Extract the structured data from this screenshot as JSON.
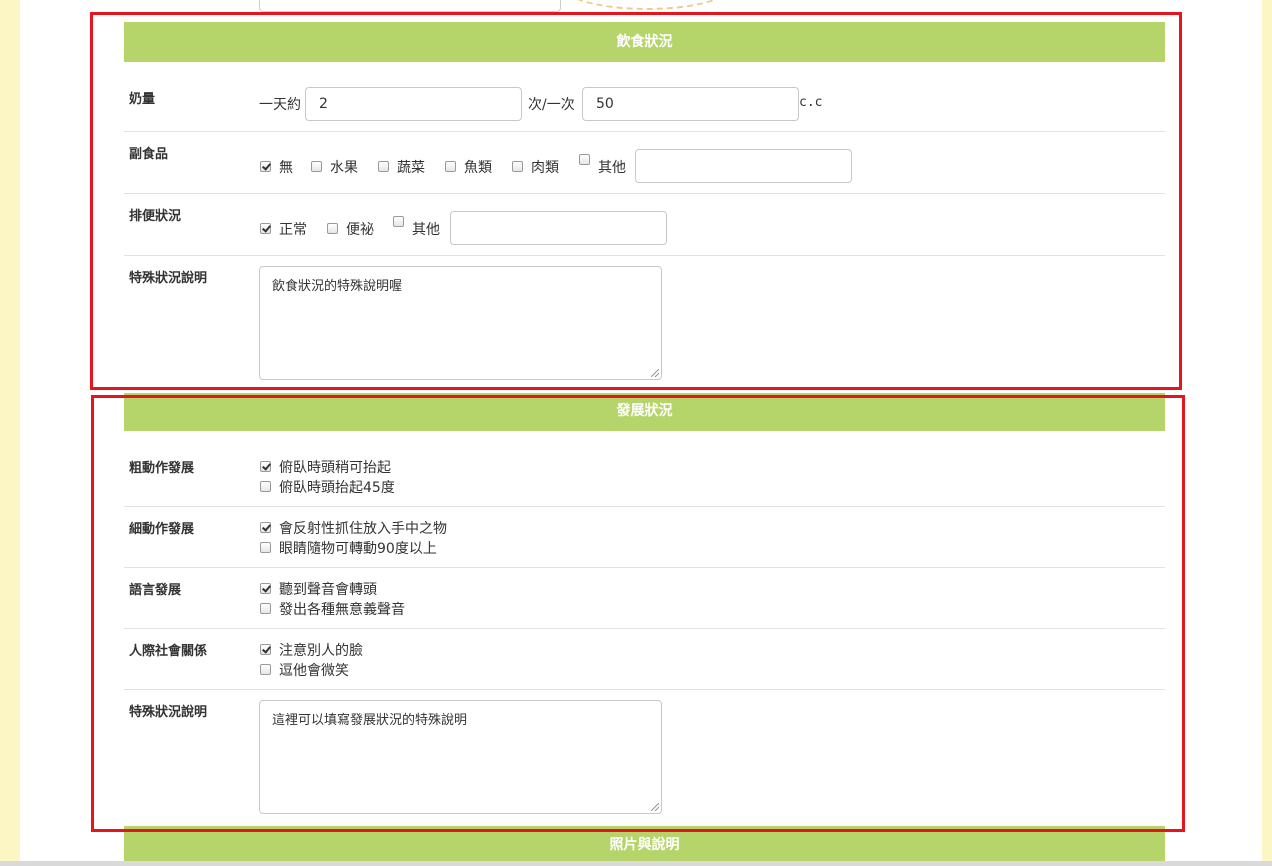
{
  "sections": {
    "diet": {
      "title": "飲食狀況",
      "milk": {
        "label": "奶量",
        "prefix": "一天約",
        "times_value": "2",
        "mid_text": "次/一次",
        "amount_value": "50",
        "unit": "c.c"
      },
      "supplement": {
        "label": "副食品",
        "options": [
          {
            "label": "無",
            "checked": true
          },
          {
            "label": "水果",
            "checked": false
          },
          {
            "label": "蔬菜",
            "checked": false
          },
          {
            "label": "魚類",
            "checked": false
          },
          {
            "label": "肉類",
            "checked": false
          },
          {
            "label": "其他",
            "checked": false
          }
        ],
        "other_value": ""
      },
      "bowel": {
        "label": "排便狀況",
        "options": [
          {
            "label": "正常",
            "checked": true
          },
          {
            "label": "便祕",
            "checked": false
          },
          {
            "label": "其他",
            "checked": false
          }
        ],
        "other_value": ""
      },
      "special": {
        "label": "特殊狀況說明",
        "value": "飲食狀況的特殊說明喔"
      }
    },
    "development": {
      "title": "發展狀況",
      "gross_motor": {
        "label": "粗動作發展",
        "options": [
          {
            "label": "俯臥時頭稍可抬起",
            "checked": true
          },
          {
            "label": "俯臥時頭抬起45度",
            "checked": false
          }
        ]
      },
      "fine_motor": {
        "label": "細動作發展",
        "options": [
          {
            "label": "會反射性抓住放入手中之物",
            "checked": true
          },
          {
            "label": "眼睛隨物可轉動90度以上",
            "checked": false
          }
        ]
      },
      "language": {
        "label": "語言發展",
        "options": [
          {
            "label": "聽到聲音會轉頭",
            "checked": true
          },
          {
            "label": "發出各種無意義聲音",
            "checked": false
          }
        ]
      },
      "social": {
        "label": "人際社會關係",
        "options": [
          {
            "label": "注意別人的臉",
            "checked": true
          },
          {
            "label": "逗他會微笑",
            "checked": false
          }
        ]
      },
      "special": {
        "label": "特殊狀況說明",
        "value": "這裡可以填寫發展狀況的特殊說明"
      }
    },
    "photos": {
      "title": "照片與說明"
    }
  },
  "colors": {
    "header_green": "#b5d56a",
    "highlight_red": "#e8141b",
    "side_yellow": "#fbf6c3"
  }
}
